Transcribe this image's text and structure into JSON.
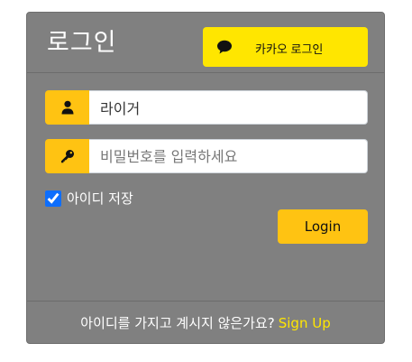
{
  "header": {
    "title": "로그인",
    "kakao_button_label": "카카오 로그인"
  },
  "form": {
    "username": {
      "value": "라이거",
      "icon": "user-icon"
    },
    "password": {
      "value": "",
      "placeholder": "비밀번호를 입력하세요",
      "icon": "key-icon"
    },
    "remember_label": "아이디 저장",
    "remember_checked": true,
    "login_button_label": "Login"
  },
  "footer": {
    "question_text": "아이디를 가지고 계시지 않은가요?",
    "signup_link_label": "Sign Up"
  },
  "colors": {
    "card_background": "#808080",
    "kakao_yellow": "#ffe600",
    "accent_yellow": "#ffc312",
    "signup_link": "#ffe600"
  }
}
